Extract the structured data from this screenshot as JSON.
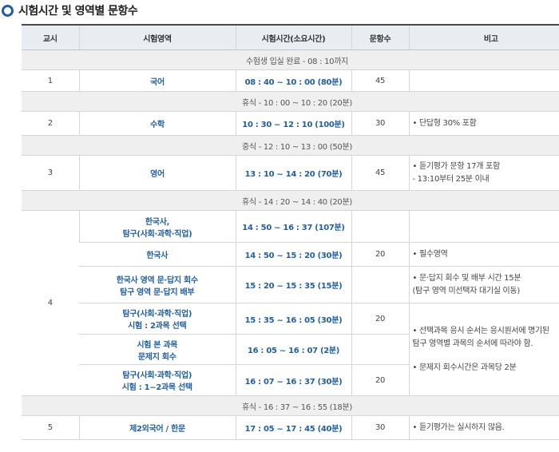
{
  "heading": "시험시간 및 영역별 문항수",
  "columns": [
    "교시",
    "시험영역",
    "시험시간(소요시간)",
    "문항수",
    "비고"
  ],
  "bands": {
    "entry": "수험생 입실 완료 - 08 : 10까지",
    "break1": "휴식 - 10 : 00 ~ 10 : 20 (20분)",
    "lunch": "중식 - 12 : 10 ~ 13 : 00 (50분)",
    "break2": "휴식 - 14 : 20 ~ 14 : 40 (20분)",
    "break3": "휴식 - 16 : 37 ~ 16 : 55 (18분)"
  },
  "p1": {
    "period": "1",
    "subject": "국어",
    "time": "08 : 40 ~ 10 : 00 (80분)",
    "count": "45"
  },
  "p2": {
    "period": "2",
    "subject": "수학",
    "time": "10 : 30 ~ 12 : 10 (100분)",
    "count": "30",
    "note": "• 단답형 30% 포함"
  },
  "p3": {
    "period": "3",
    "subject": "영어",
    "time": "13 : 10 ~ 14 : 20 (70분)",
    "count": "45",
    "note1": "• 듣기평가 문항 17개 포함",
    "note2": "- 13:10부터 25분 이내"
  },
  "p4": {
    "period": "4",
    "r1": {
      "subject1": "한국사,",
      "subject2": "탐구(사회·과학·직업)",
      "time": "14 : 50 ~ 16 : 37 (107분)"
    },
    "r2": {
      "subject": "한국사",
      "time": "14 : 50 ~ 15 : 20 (30분)",
      "count": "20",
      "note": "• 필수영역"
    },
    "r3": {
      "subject1": "한국사 영역 문·답지 회수",
      "subject2": "탐구 영역 문·답지 배부",
      "time": "15 : 20 ~ 15 : 35 (15분)",
      "note1": "• 문·답지 회수 및 배부 시간 15분",
      "note2": "(탐구 영역 미선택자 대기실 이동)"
    },
    "r4": {
      "subject1": "탐구(사회·과학·직업)",
      "subject2": "시험 : 2과목 선택",
      "time": "15 : 35 ~ 16 : 05 (30분)",
      "count": "20"
    },
    "r5": {
      "subject1": "시험 본 과목",
      "subject2": "문제지 회수",
      "time": "16 : 05 ~ 16 : 07 (2분)"
    },
    "r6": {
      "subject1": "탐구(사회·과학·직업)",
      "subject2": "시험 : 1~2과목 선택",
      "time": "16 : 07 ~ 16 : 37 (30분)",
      "count": "20"
    },
    "note_a1": "• 선택과목 응시 순서는 응시원서에 명기된",
    "note_a2": "탐구 영역별 과목의 순서에 따라야 함.",
    "note_b": "• 문제지 회수시간은 과목당 2분"
  },
  "p5": {
    "period": "5",
    "subject": "제2외국어 / 한문",
    "time": "17 : 05 ~ 17 : 45 (40분)",
    "count": "30",
    "note": "• 듣기평가는 실시하지 않음."
  }
}
